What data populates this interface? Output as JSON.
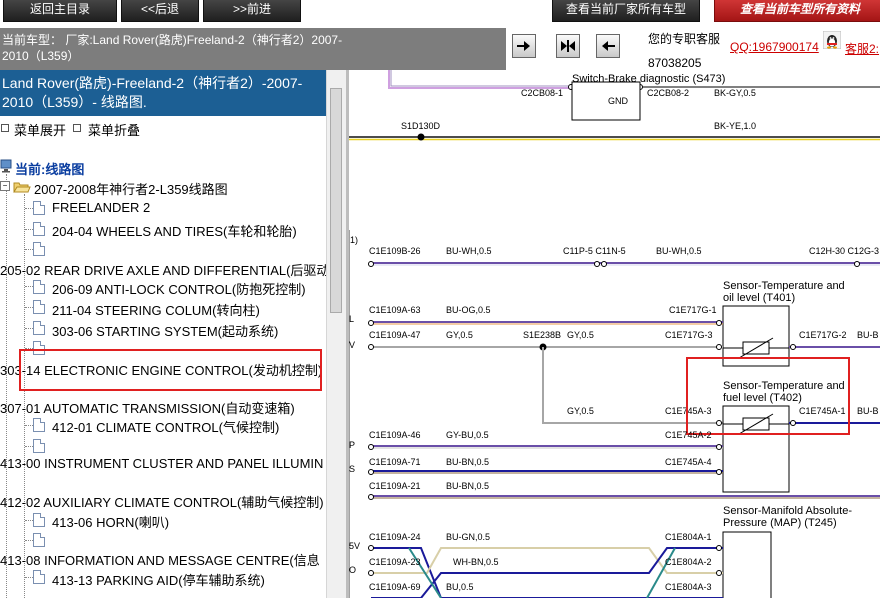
{
  "topnav": {
    "back_home": "返回主目录",
    "back": "<<后退",
    "forward": ">>前进",
    "view_all_manufacturer": "查看当前厂家所有车型",
    "view_all_current": "查看当前车型所有资料"
  },
  "vehicle": {
    "current_line1": "当前车型：  厂家:Land Rover(路虎)Freeland-2（神行者2）2007-",
    "current_line2": "2010（L359）"
  },
  "contact": {
    "label": "您的专职客服",
    "qq": "QQ:1967900174",
    "service2": "客服2:",
    "phone": "87038205"
  },
  "sidebar": {
    "header_line1": "Land Rover(路虎)-Freeland-2（神行者2）-2007-",
    "header_line2": "2010（L359）- 线路图.",
    "expand": "菜单展开",
    "collapse": "菜单折叠",
    "current": "当前:线路图",
    "folder": "2007-2008年神行者2-L359线路图",
    "items": [
      "FREELANDER 2",
      "204-04 WHEELS AND TIRES(车轮和轮胎)",
      "",
      "205-02 REAR DRIVE AXLE AND DIFFERENTIAL(后驱动",
      "206-09 ANTI-LOCK CONTROL(防抱死控制)",
      "211-04 STEERING COLUM(转向柱)",
      "303-06 STARTING SYSTEM(起动系统)",
      "",
      "303-14 ELECTRONIC ENGINE CONTROL(发动机控制)",
      "307-01 AUTOMATIC TRANSMISSION(自动变速箱)",
      "412-01 CLIMATE CONTROL(气候控制)",
      "",
      "413-00 INSTRUMENT CLUSTER AND PANEL ILLUMIN",
      "412-02 AUXILIARY CLIMATE CONTROL(辅助气候控制)",
      "413-06 HORN(喇叭)",
      "",
      "413-08 INFORMATION AND MESSAGE CENTRE(信息",
      "413-13 PARKING AID(停车辅助系统)"
    ]
  },
  "diagram": {
    "switch_brake": "Switch-Brake diagnostic (S473)",
    "gnd": "GND",
    "c2cb08_1": "C2CB08-1",
    "c2cb08_2": "C2CB08-2",
    "bk_gy": "BK-GY,0.5",
    "s1d130d": "S1D130D",
    "bk_ye": "BK-YE,1.0",
    "marker_1": "1)",
    "c1e109b_26": "C1E109B-26",
    "bu_wh_1": "BU-WH,0.5",
    "c11p5": "C11P-5 C11N-5",
    "bu_wh_2": "BU-WH,0.5",
    "c12h30": "C12H-30 C12G-3",
    "sensor_oil_1": "Sensor-Temperature and",
    "sensor_oil_2": "oil level (T401)",
    "c1e109a_63": "C1E109A-63",
    "bu_og": "BU-OG,0.5",
    "c1e717g_1": "C1E717G-1",
    "c1e109a_47": "C1E109A-47",
    "gy_1": "GY,0.5",
    "s1e238b": "S1E238B",
    "gy_2": "GY,0.5",
    "c1e717g_3": "C1E717G-3",
    "c1e717g_2": "C1E717G-2",
    "bu_b_1": "BU-B",
    "sensor_fuel_1": "Sensor-Temperature and",
    "sensor_fuel_2": "fuel level (T402)",
    "gy_3": "GY,0.5",
    "c1e745a_3": "C1E745A-3",
    "c1e745a_1": "C1E745A-1",
    "bu_b_2": "BU-B",
    "c1e109a_46": "C1E109A-46",
    "gy_bu": "GY-BU,0.5",
    "c1e745a_2": "C1E745A-2",
    "c1e109a_71": "C1E109A-71",
    "bu_bn_1": "BU-BN,0.5",
    "c1e745a_4": "C1E745A-4",
    "c1e109a_21": "C1E109A-21",
    "bu_bn_2": "BU-BN,0.5",
    "sensor_map_1": "Sensor-Manifold Absolute-",
    "sensor_map_2": "Pressure (MAP) (T245)",
    "c1e109a_24": "C1E109A-24",
    "bu_gn": "BU-GN,0.5",
    "c1e804a_1": "C1E804A-1",
    "c1e109a_23": "C1E109A-23",
    "wh_bn": "WH-BN,0.5",
    "c1e804a_2": "C1E804A-2",
    "c1e109a_69": "C1E109A-69",
    "bu_05": "BU,0.5",
    "c1e804a_3": "C1E804A-3",
    "left_l": "L",
    "left_v": "V",
    "left_p": "P",
    "left_s": "S",
    "left_5v": "5V",
    "left_o": "O"
  },
  "colors": {
    "sidebar_header": "#1c5f94",
    "vehicle_bar": "#7d7d7d",
    "highlight_box": "#e02020",
    "wire_purple": "#6a4fa8",
    "wire_grey": "#a6a6a6",
    "wire_navy": "#1a1a9a"
  }
}
